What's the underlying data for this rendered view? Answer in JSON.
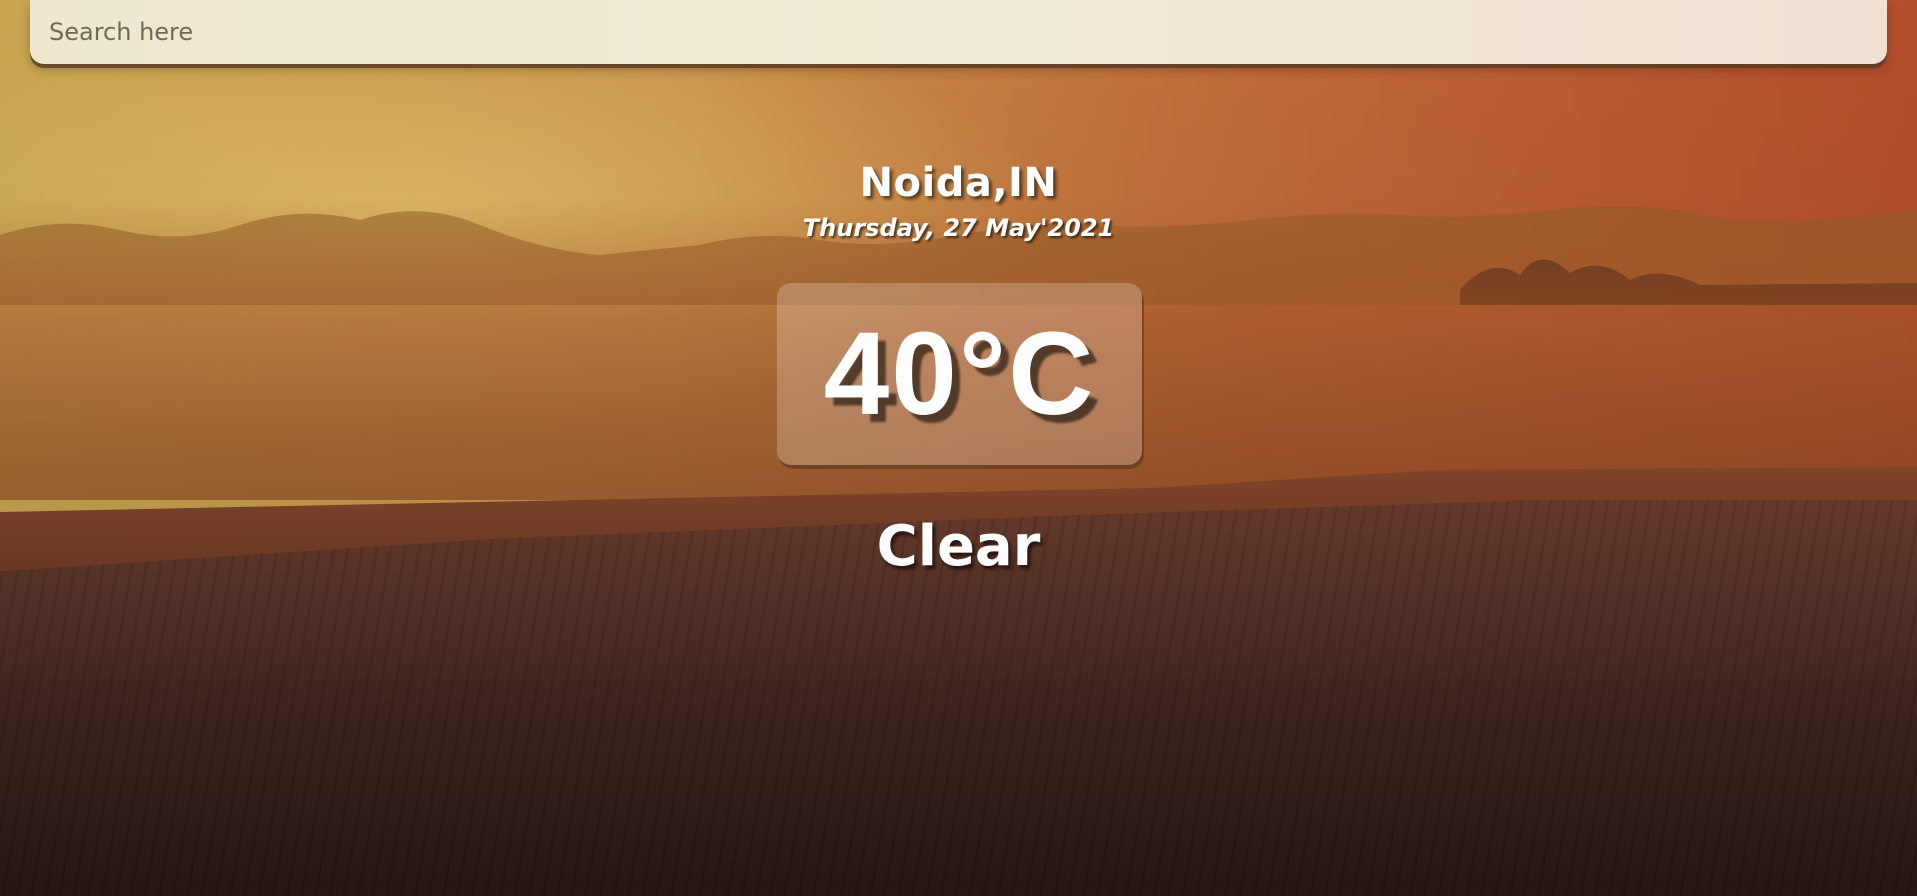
{
  "search": {
    "placeholder": "Search here"
  },
  "weather": {
    "location": "Noida,IN",
    "date": "Thursday, 27 May'2021",
    "temperature": "40°C",
    "condition": "Clear"
  },
  "colors": {
    "text": "#ffffff",
    "search_bg": "#f2ecd6"
  }
}
